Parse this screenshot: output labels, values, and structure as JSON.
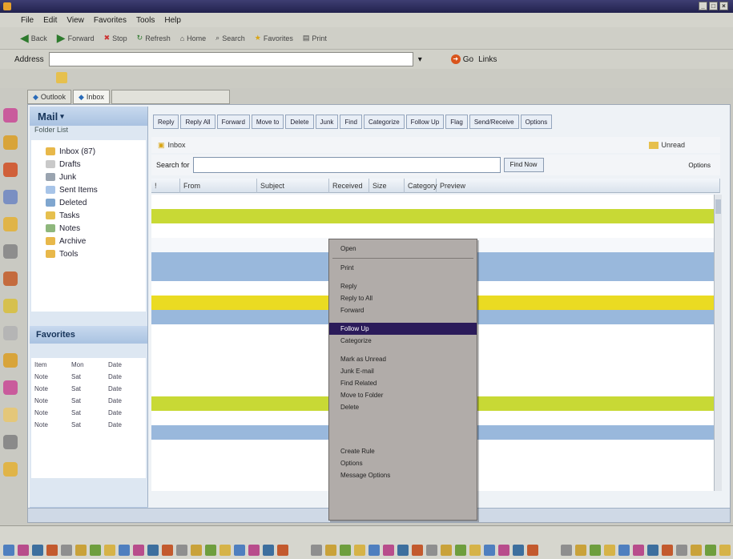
{
  "window": {
    "title": "",
    "controls": [
      "_",
      "□",
      "×"
    ]
  },
  "menubar": {
    "items": [
      "File",
      "Edit",
      "View",
      "Favorites",
      "Tools",
      "Help"
    ]
  },
  "toolbar": {
    "items": [
      "Back",
      "Forward",
      "Stop",
      "Refresh",
      "Home",
      "Search",
      "Favorites",
      "Print"
    ]
  },
  "addressbar": {
    "label": "Address",
    "value": "",
    "go_label": "Go",
    "links_label": "Links"
  },
  "tabs": [
    {
      "label": "Outlook"
    },
    {
      "label": "Inbox"
    },
    {
      "label": ""
    }
  ],
  "outlook": {
    "nav_title": "Mail",
    "nav_sub": "Folder List",
    "folders": [
      {
        "label": "Inbox (87)",
        "color": "#e8b84a"
      },
      {
        "label": "Drafts",
        "color": "#c9c9c9"
      },
      {
        "label": "Junk",
        "color": "#9aa4b0"
      },
      {
        "label": "Sent Items",
        "color": "#a7c4e8"
      },
      {
        "label": "Deleted",
        "color": "#7fa6cf"
      },
      {
        "label": "Tasks",
        "color": "#e6c04e"
      },
      {
        "label": "Notes",
        "color": "#8eb77c"
      },
      {
        "label": "Archive",
        "color": "#e8b84a"
      },
      {
        "label": "Tools",
        "color": "#e8b84a"
      }
    ],
    "nav_section": "Favorites",
    "nav_section_sub": "",
    "mini_rows": [
      [
        "Item",
        "Mon",
        "Date"
      ],
      [
        "Note",
        "Sat",
        "Date"
      ],
      [
        "Note",
        "Sat",
        "Date"
      ],
      [
        "Note",
        "Sat",
        "Date"
      ],
      [
        "Note",
        "Sat",
        "Date"
      ],
      [
        "Note",
        "Sat",
        "Date"
      ]
    ],
    "nav_footer": "",
    "mail_toolbar": [
      "Reply",
      "Reply All",
      "Forward",
      "Move to",
      "Delete",
      "Junk",
      "Find",
      "Categorize",
      "Follow Up",
      "Flag",
      "Send/Receive",
      "Options"
    ],
    "folder_header": {
      "title": "Inbox",
      "right_a": "Unread",
      "right_b": ""
    },
    "search": {
      "label": "Search for",
      "placeholder": "",
      "button": "Find Now",
      "options": "Options"
    },
    "columns": [
      "!",
      "From",
      "Subject",
      "Received",
      "Size",
      "Category",
      "Preview"
    ],
    "rows": [
      {
        "style": "white",
        "ico": "",
        "from": "",
        "sub": "",
        "recv": "",
        "size": "",
        "cat": "",
        "prev": ""
      },
      {
        "style": "green",
        "ico": "",
        "from": "",
        "sub": "",
        "recv": "",
        "size": "",
        "cat": "",
        "prev": ""
      },
      {
        "style": "white",
        "ico": "",
        "from": "",
        "sub": "",
        "recv": "",
        "size": "",
        "cat": "",
        "prev": ""
      },
      {
        "style": "light",
        "ico": "",
        "from": "",
        "sub": "",
        "recv": "",
        "size": "",
        "cat": "",
        "prev": ""
      },
      {
        "style": "blue",
        "ico": "",
        "from": "",
        "sub": "",
        "recv": "",
        "size": "",
        "cat": "",
        "prev": ""
      },
      {
        "style": "blue",
        "ico": "",
        "from": "",
        "sub": "",
        "recv": "",
        "size": "",
        "cat": "",
        "prev": ""
      },
      {
        "style": "white",
        "ico": "",
        "from": "",
        "sub": "",
        "recv": "",
        "size": "",
        "cat": "",
        "prev": ""
      },
      {
        "style": "yellow",
        "ico": "",
        "from": "",
        "sub": "",
        "recv": "",
        "size": "",
        "cat": "",
        "prev": ""
      },
      {
        "style": "blue",
        "ico": "",
        "from": "",
        "sub": "",
        "recv": "",
        "size": "",
        "cat": "",
        "prev": ""
      },
      {
        "style": "white",
        "ico": "",
        "from": "",
        "sub": "",
        "recv": "",
        "size": "",
        "cat": "",
        "prev": "",
        "orange": true
      },
      {
        "style": "white",
        "ico": "",
        "from": "",
        "sub": "",
        "recv": "",
        "size": "",
        "cat": "",
        "prev": ""
      },
      {
        "style": "white",
        "ico": "",
        "from": "",
        "sub": "",
        "recv": "",
        "size": "",
        "cat": "",
        "prev": ""
      },
      {
        "style": "white",
        "ico": "",
        "from": "",
        "sub": "",
        "recv": "",
        "size": "",
        "cat": "",
        "prev": ""
      },
      {
        "style": "white",
        "ico": "",
        "from": "",
        "sub": "",
        "recv": "",
        "size": "",
        "cat": "",
        "prev": "",
        "orange": true
      },
      {
        "style": "green",
        "ico": "",
        "from": "",
        "sub": "",
        "recv": "",
        "size": "",
        "cat": "",
        "prev": ""
      },
      {
        "style": "white",
        "ico": "",
        "from": "",
        "sub": "",
        "recv": "",
        "size": "",
        "cat": "",
        "prev": "",
        "orange": true
      },
      {
        "style": "blue",
        "ico": "",
        "from": "",
        "sub": "",
        "recv": "",
        "size": "",
        "cat": "",
        "prev": ""
      },
      {
        "style": "white",
        "ico": "",
        "from": "",
        "sub": "",
        "recv": "",
        "size": "",
        "cat": "",
        "prev": ""
      }
    ],
    "page_status": ""
  },
  "context_menu": {
    "items": [
      {
        "label": "Open",
        "shortcut": ""
      },
      {
        "sep": true
      },
      {
        "label": "Print",
        "shortcut": ""
      },
      {
        "gap": true
      },
      {
        "label": "Reply",
        "shortcut": ""
      },
      {
        "label": "Reply to All",
        "shortcut": ""
      },
      {
        "label": "Forward",
        "shortcut": ""
      },
      {
        "gap": true
      },
      {
        "label": "Follow Up",
        "shortcut": "",
        "selected": true
      },
      {
        "label": "Categorize",
        "shortcut": ""
      },
      {
        "gap": true
      },
      {
        "label": "Mark as Unread",
        "shortcut": ""
      },
      {
        "label": "Junk E-mail",
        "shortcut": ""
      },
      {
        "label": "Find Related",
        "shortcut": ""
      },
      {
        "label": "Move to Folder",
        "shortcut": ""
      },
      {
        "label": "Delete",
        "shortcut": ""
      },
      {
        "gap": true
      },
      {
        "gap": true
      },
      {
        "gap": true
      },
      {
        "gap": true
      },
      {
        "gap": true
      },
      {
        "label": "Create Rule",
        "shortcut": ""
      },
      {
        "label": "Options",
        "shortcut": ""
      },
      {
        "label": "Message Options",
        "shortcut": ""
      }
    ]
  },
  "taskbar": {
    "clock": ""
  },
  "colors": {
    "green_row": "#c8d935",
    "blue_row": "#99b8dc",
    "yellow_row": "#eadb22",
    "menu_highlight": "#2b1b5a"
  }
}
